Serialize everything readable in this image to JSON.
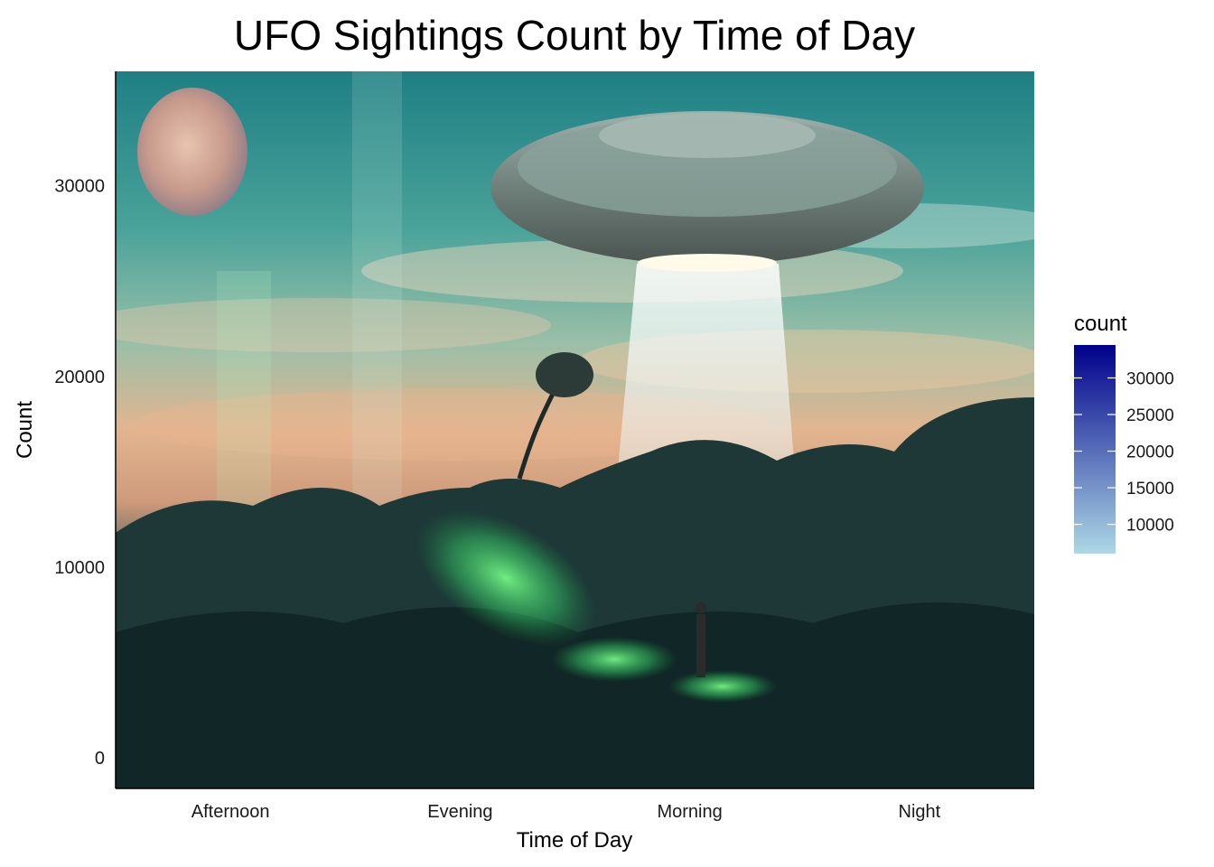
{
  "chart_data": {
    "type": "bar",
    "title": "UFO Sightings Count by Time of Day",
    "xlabel": "Time of Day",
    "ylabel": "Count",
    "categories": [
      "Afternoon",
      "Evening",
      "Morning",
      "Night"
    ],
    "values": [
      null,
      null,
      null,
      null
    ],
    "ylim": [
      -1600,
      36000
    ],
    "yticks": [
      0,
      10000,
      20000,
      30000
    ],
    "grid": false,
    "background": "photograph of a UFO over a rocky landscape at dusk",
    "legend": {
      "title": "count",
      "placement": "right",
      "ticks": [
        10000,
        15000,
        20000,
        25000,
        30000
      ],
      "range": [
        6000,
        34500
      ],
      "low_color": "#add8e6",
      "high_color": "#00008b"
    }
  }
}
